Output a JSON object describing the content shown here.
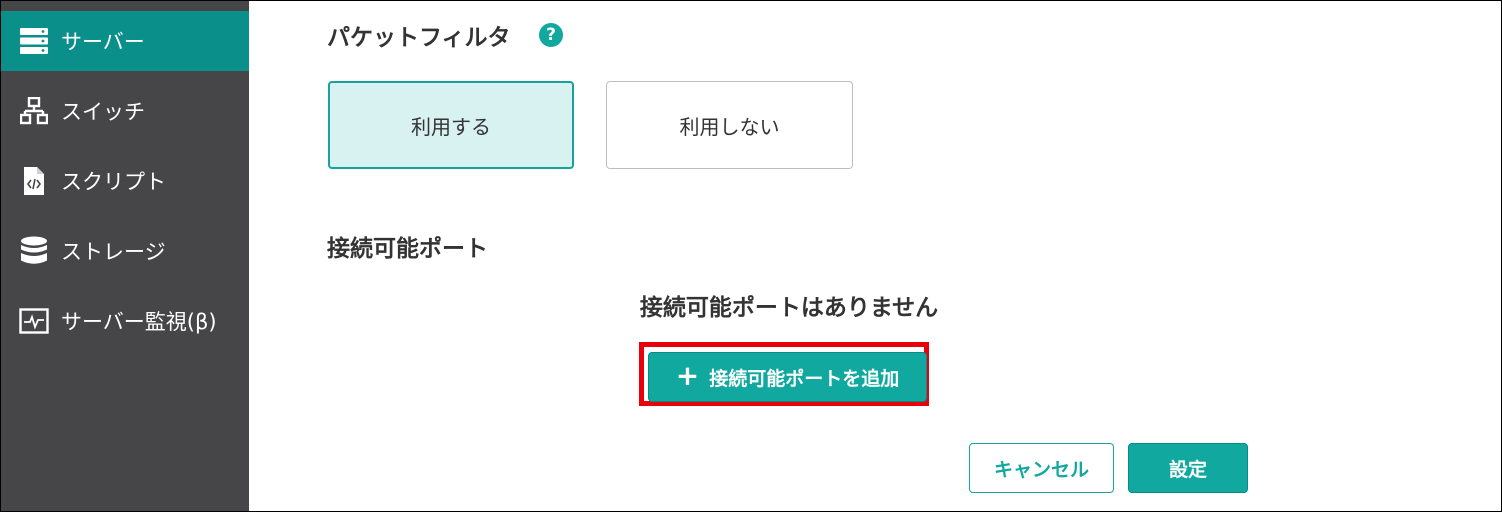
{
  "sidebar": {
    "items": [
      {
        "label": "サーバー",
        "icon": "server-icon",
        "active": true
      },
      {
        "label": "スイッチ",
        "icon": "network-switch-icon",
        "active": false
      },
      {
        "label": "スクリプト",
        "icon": "script-file-icon",
        "active": false
      },
      {
        "label": "ストレージ",
        "icon": "database-icon",
        "active": false
      },
      {
        "label": "サーバー監視(β)",
        "icon": "monitor-chart-icon",
        "active": false
      }
    ]
  },
  "packet_filter": {
    "title": "パケットフィルタ",
    "help_icon": "?",
    "options": [
      {
        "label": "利用する",
        "selected": true
      },
      {
        "label": "利用しない",
        "selected": false
      }
    ]
  },
  "ports": {
    "title": "接続可能ポート",
    "empty_message": "接続可能ポートはありません",
    "add_button_icon": "+",
    "add_button_label": "接続可能ポートを追加"
  },
  "footer": {
    "cancel_label": "キャンセル",
    "save_label": "設定"
  },
  "colors": {
    "accent": "#11a8a0",
    "sidebar_bg": "#464649",
    "sidebar_active": "#0a8f8a",
    "highlight": "#e8000a",
    "selected_bg": "#d8f1f1"
  }
}
